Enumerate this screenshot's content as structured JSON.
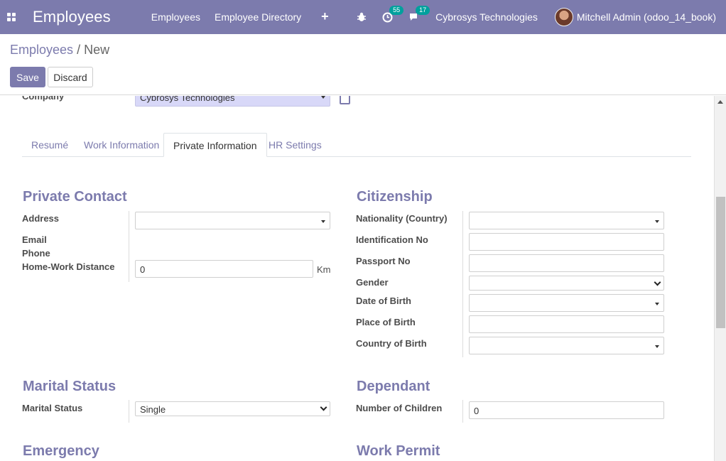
{
  "navbar": {
    "app_title": "Employees",
    "menu": [
      "Employees",
      "Employee Directory"
    ],
    "plus_label": "+",
    "activity_count": "55",
    "messages_count": "17",
    "company": "Cybrosys Technologies",
    "user": "Mitchell Admin (odoo_14_book)"
  },
  "control": {
    "breadcrumb_parent": "Employees",
    "breadcrumb_sep": "/",
    "breadcrumb_current": "New",
    "save_label": "Save",
    "discard_label": "Discard"
  },
  "form": {
    "company_label": "Company",
    "company_value": "Cybrosys Technologies",
    "tabs": [
      "Resumé",
      "Work Information",
      "Private Information",
      "HR Settings"
    ],
    "active_tab": "Private Information",
    "private_contact": {
      "title": "Private Contact",
      "address_label": "Address",
      "address_value": "",
      "email_label": "Email",
      "phone_label": "Phone",
      "distance_label": "Home-Work Distance",
      "distance_value": "0",
      "distance_unit": "Km"
    },
    "citizenship": {
      "title": "Citizenship",
      "nationality_label": "Nationality (Country)",
      "nationality_value": "",
      "identification_label": "Identification No",
      "identification_value": "",
      "passport_label": "Passport No",
      "passport_value": "",
      "gender_label": "Gender",
      "gender_value": "",
      "dob_label": "Date of Birth",
      "dob_value": "",
      "pob_label": "Place of Birth",
      "pob_value": "",
      "cob_label": "Country of Birth",
      "cob_value": ""
    },
    "marital": {
      "title": "Marital Status",
      "label": "Marital Status",
      "value": "Single"
    },
    "dependant": {
      "title": "Dependant",
      "children_label": "Number of Children",
      "children_value": "0"
    },
    "emergency": {
      "title": "Emergency"
    },
    "work_permit": {
      "title": "Work Permit"
    }
  },
  "colors": {
    "brand": "#7c7bad",
    "badge": "#00a09d",
    "company_field_bg": "#d8d8f8"
  },
  "icons": [
    "apps-icon",
    "bug-icon",
    "activity-clock-icon",
    "chat-icon",
    "external-link-icon",
    "dropdown-caret-icon"
  ]
}
